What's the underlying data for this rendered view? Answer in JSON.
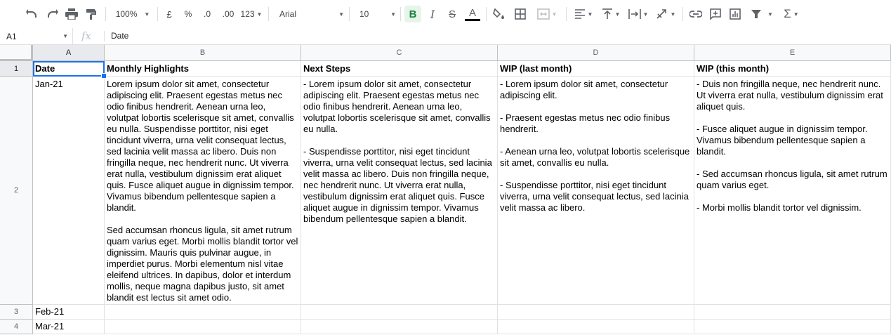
{
  "toolbar": {
    "zoom": "100%",
    "currency": "£",
    "percent": "%",
    "dec_decrease": ".0",
    "dec_increase": ".00",
    "more_formats": "123",
    "font": "Arial",
    "font_size": "10",
    "bold": "B",
    "italic": "I",
    "strikethrough": "S",
    "text_color_letter": "A",
    "accent_color": "#188038",
    "text_color": "#000000"
  },
  "formula_bar": {
    "cell_ref": "A1",
    "fx": "fx",
    "value": "Date"
  },
  "grid": {
    "columns": [
      "A",
      "B",
      "C",
      "D",
      "E"
    ],
    "rows": [
      "1",
      "2",
      "3",
      "4"
    ],
    "headers": {
      "a": "Date",
      "b": "Monthly Highlights",
      "c": "Next Steps",
      "d": "WIP (last month)",
      "e": "WIP (this month)"
    },
    "row2": {
      "a": "Jan-21",
      "b": "Lorem ipsum dolor sit amet, consectetur adipiscing elit. Praesent egestas metus nec odio finibus hendrerit. Aenean urna leo, volutpat lobortis scelerisque sit amet, convallis eu nulla. Suspendisse porttitor, nisi eget tincidunt viverra, urna velit consequat lectus, sed lacinia velit massa ac libero. Duis non fringilla neque, nec hendrerit nunc. Ut viverra erat nulla, vestibulum dignissim erat aliquet quis. Fusce aliquet augue in dignissim tempor. Vivamus bibendum pellentesque sapien a blandit.\n\nSed accumsan rhoncus ligula, sit amet rutrum quam varius eget. Morbi mollis blandit tortor vel dignissim. Mauris quis pulvinar augue, in imperdiet purus. Morbi elementum nisl vitae eleifend ultrices. In dapibus, dolor et interdum mollis, neque magna dapibus justo, sit amet blandit est lectus sit amet odio.",
      "c": "- Lorem ipsum dolor sit amet, consectetur adipiscing elit. Praesent egestas metus nec odio finibus hendrerit. Aenean urna leo, volutpat lobortis scelerisque sit amet, convallis eu nulla.\n\n- Suspendisse porttitor, nisi eget tincidunt viverra, urna velit consequat lectus, sed lacinia velit massa ac libero. Duis non fringilla neque, nec hendrerit nunc. Ut viverra erat nulla, vestibulum dignissim erat aliquet quis. Fusce aliquet augue in dignissim tempor. Vivamus bibendum pellentesque sapien a blandit.",
      "d": "- Lorem ipsum dolor sit amet, consectetur adipiscing elit.\n\n- Praesent egestas metus nec odio finibus hendrerit.\n\n- Aenean urna leo, volutpat lobortis scelerisque sit amet, convallis eu nulla.\n\n- Suspendisse porttitor, nisi eget tincidunt viverra, urna velit consequat lectus, sed lacinia velit massa ac libero.",
      "e": "- Duis non fringilla neque, nec hendrerit nunc. Ut viverra erat nulla, vestibulum dignissim erat aliquet quis.\n\n- Fusce aliquet augue in dignissim tempor. Vivamus bibendum pellentesque sapien a blandit.\n\n- Sed accumsan rhoncus ligula, sit amet rutrum quam varius eget.\n\n- Morbi mollis blandit tortor vel dignissim."
    },
    "row3": {
      "a": "Feb-21"
    },
    "row4": {
      "a": "Mar-21"
    }
  }
}
